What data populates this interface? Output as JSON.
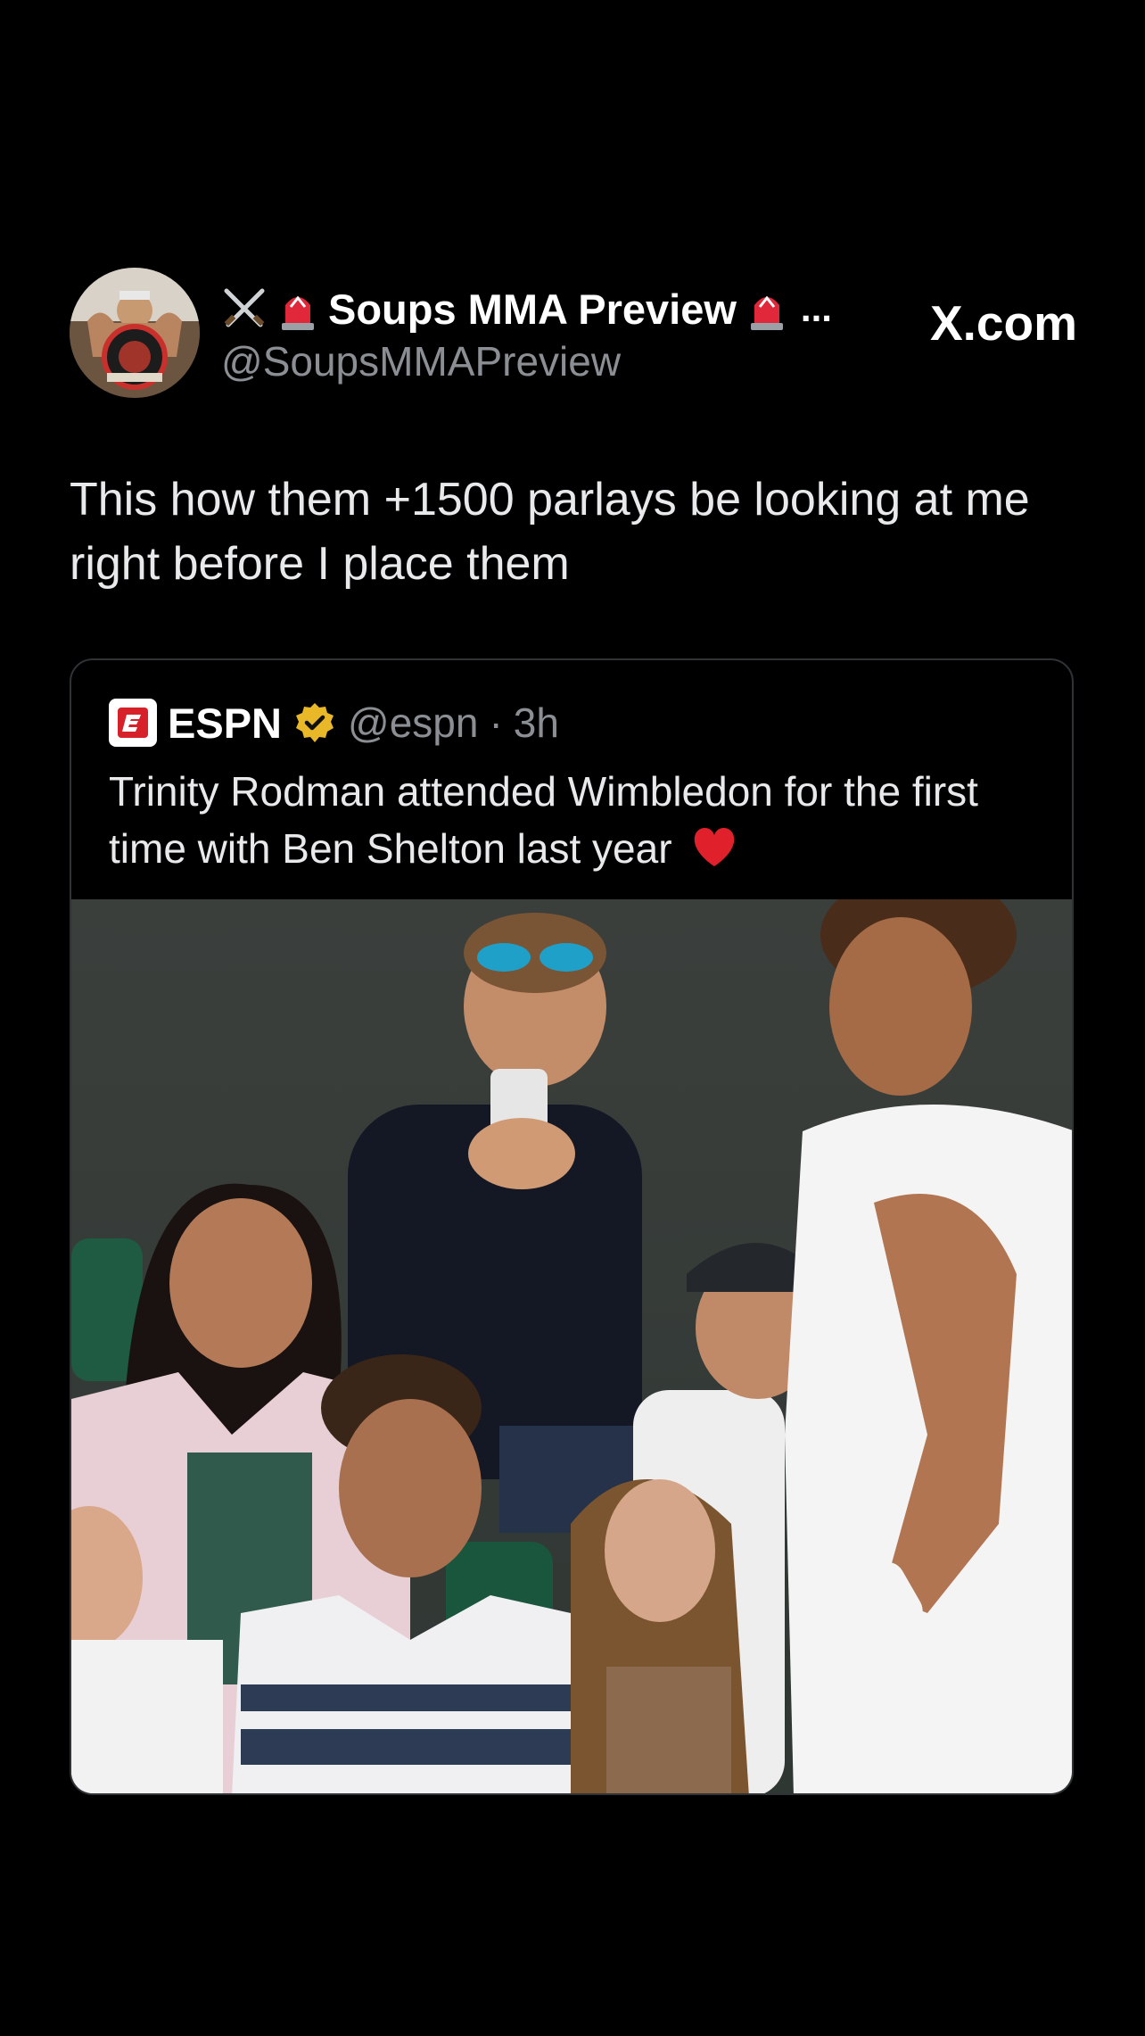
{
  "post": {
    "author": {
      "display_name": "Soups MMA Preview",
      "handle": "@SoupsMMAPreview",
      "name_prefix_icons": [
        "crossed-swords-icon",
        "siren-icon"
      ],
      "name_suffix_icons": [
        "siren-icon"
      ],
      "truncation": "..."
    },
    "watermark": "X.com",
    "text": "This how them +1500 parlays be looking at me right before I place them"
  },
  "quoted_post": {
    "author": {
      "display_name": "ESPN",
      "handle": "@espn",
      "time": "3h",
      "separator": "·",
      "verified": true,
      "verified_color": "#e8b829"
    },
    "text": "Trinity Rodman attended Wimbledon for the first time with Ben Shelton last year",
    "text_emoji": "heart-icon",
    "media": {
      "type": "video-frame"
    }
  },
  "colors": {
    "background": "#000000",
    "text": "#e7e9ea",
    "secondary_text": "#8b8f94",
    "border": "#2f3336",
    "espn_red": "#d6202a"
  }
}
